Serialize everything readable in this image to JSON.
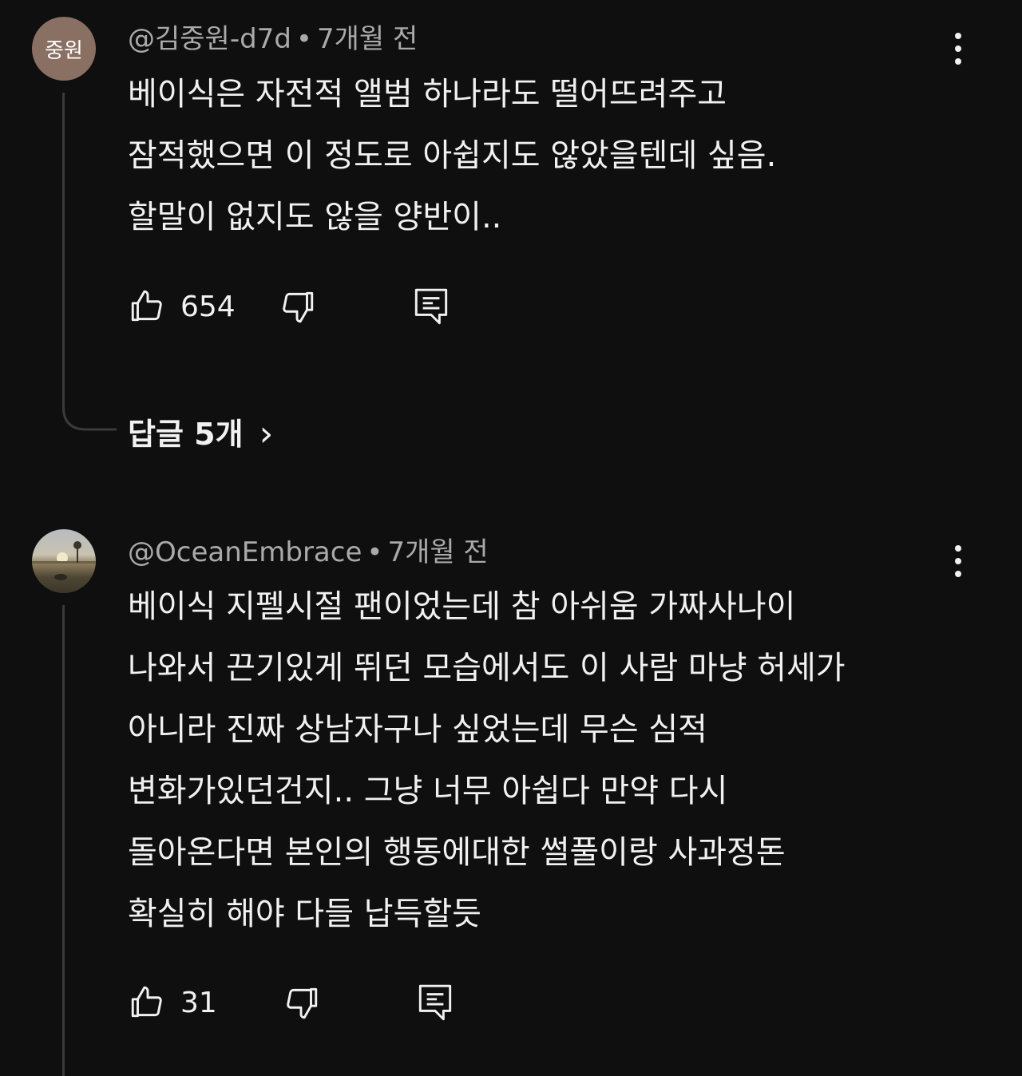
{
  "comments": [
    {
      "avatar_text": "중원",
      "author": "@김중원-d7d",
      "separator": "•",
      "time": "7개월 전",
      "lines": [
        "베이식은 자전적 앨범 하나라도 떨어뜨려주고",
        "잠적했으면 이 정도로 아쉽지도 않았을텐데 싶음.",
        "할말이 없지도 않을 양반이.."
      ],
      "likes": "654",
      "replies_label": "답글 5개",
      "replies_chevron": "›"
    },
    {
      "author": "@OceanEmbrace",
      "separator": "•",
      "time": "7개월 전",
      "lines": [
        "베이식 지펠시절 팬이었는데 참 아쉬움 가짜사나이",
        "나와서 끈기있게 뛰던 모습에서도 이 사람 마냥 허세가",
        "아니라 진짜 상남자구나 싶었는데 무슨 심적",
        "변화가있던건지.. 그냥 너무 아쉽다 만약 다시",
        "돌아온다면 본인의 행동에대한 썰풀이랑 사과정돈",
        "확실히 해야 다들 납득할듯"
      ],
      "likes": "31"
    }
  ],
  "icons": {
    "like": "thumbs-up-icon",
    "dislike": "thumbs-down-icon",
    "reply": "comment-icon",
    "menu": "more-vert-icon"
  },
  "colors": {
    "background": "#0f0f0f",
    "text": "#f1f1f1",
    "meta": "#aaaaaa",
    "avatar_bg": "#8a6f63"
  }
}
